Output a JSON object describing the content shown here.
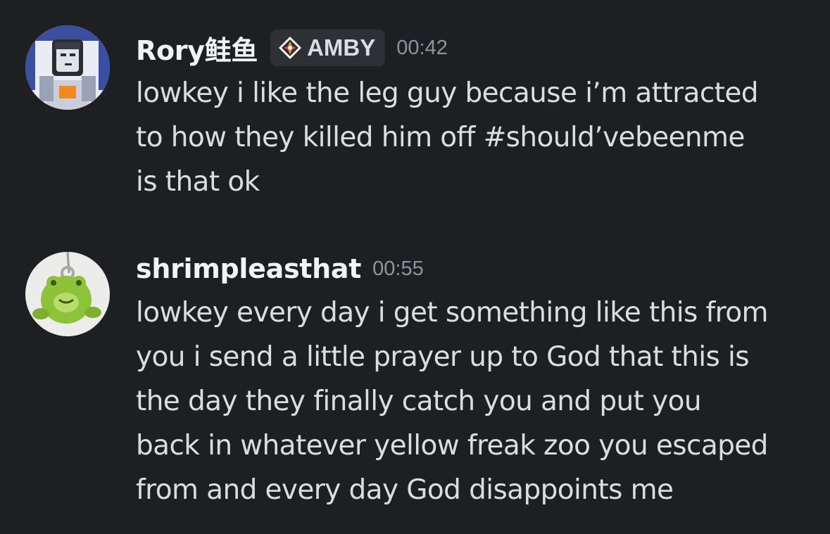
{
  "messages": [
    {
      "username": "Rory鲑鱼",
      "tag": "AMBY",
      "tag_icon": "diamond-compass-icon",
      "timestamp": "00:42",
      "lines": [
        "lowkey i like the leg guy because i’m attracted",
        "to how they killed him off #should’vebeenme",
        "is that ok"
      ]
    },
    {
      "username": "shrimpleasthat",
      "timestamp": "00:55",
      "lines": [
        "lowkey every day i get something like this from",
        "you i send a little prayer up to God that this is",
        "the day they finally catch you and put you",
        "back in whatever yellow freak zoo you escaped",
        "from and every day God disappoints me"
      ]
    }
  ],
  "colors": {
    "background": "#1e1f23",
    "username": "#f2f3f5",
    "text": "#dbdee1",
    "timestamp": "#8f939b",
    "tag_background": "#2e3036"
  }
}
